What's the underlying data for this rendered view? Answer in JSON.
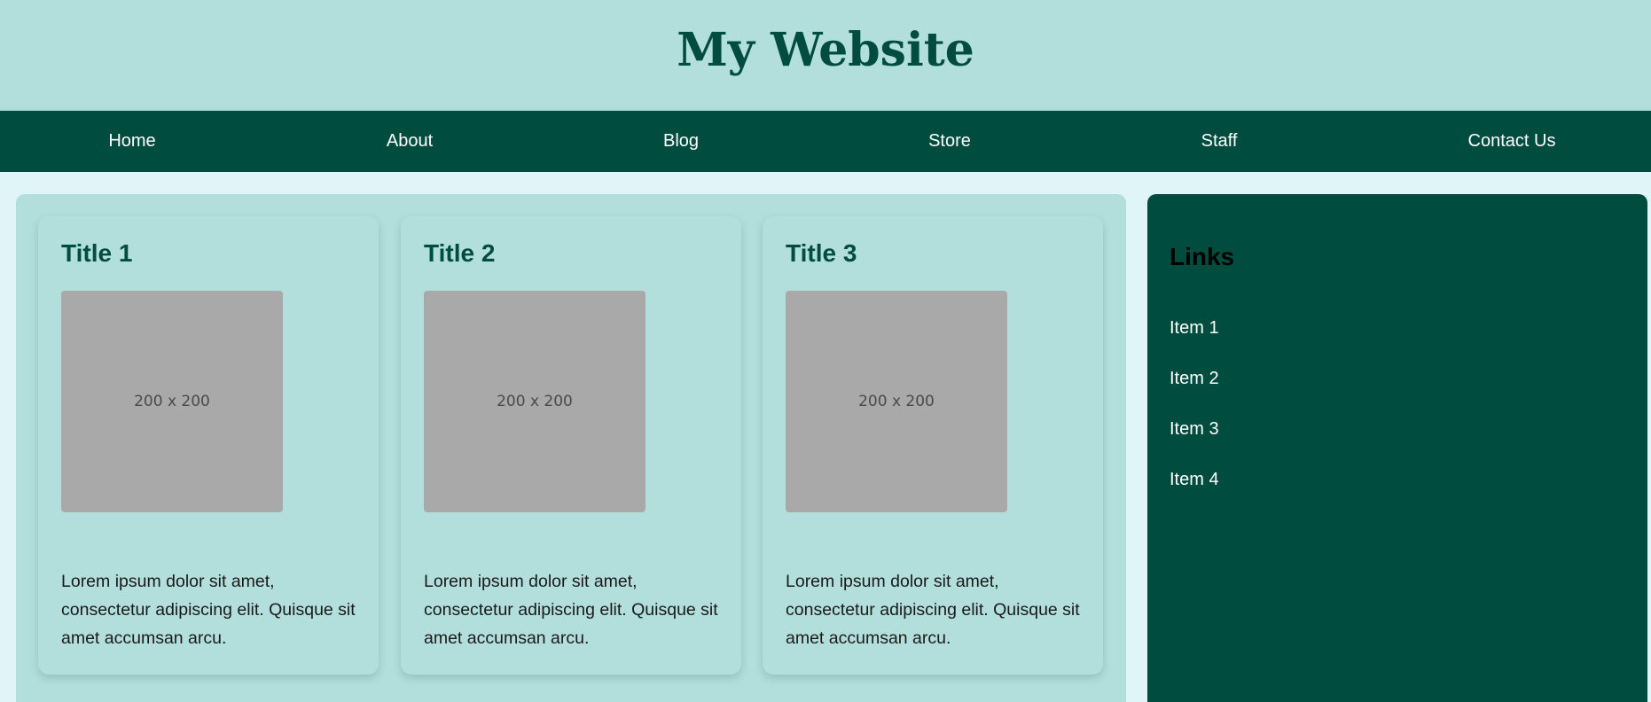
{
  "header": {
    "title": "My Website"
  },
  "nav": {
    "items": [
      {
        "label": "Home"
      },
      {
        "label": "About"
      },
      {
        "label": "Blog"
      },
      {
        "label": "Store"
      },
      {
        "label": "Staff"
      },
      {
        "label": "Contact Us"
      }
    ]
  },
  "cards": [
    {
      "title": "Title 1",
      "image_label": "200 x 200",
      "text": "Lorem ipsum dolor sit amet, consectetur adipiscing elit. Quisque sit amet accumsan arcu."
    },
    {
      "title": "Title 2",
      "image_label": "200 x 200",
      "text": "Lorem ipsum dolor sit amet, consectetur adipiscing elit. Quisque sit amet accumsan arcu."
    },
    {
      "title": "Title 3",
      "image_label": "200 x 200",
      "text": "Lorem ipsum dolor sit amet, consectetur adipiscing elit. Quisque sit amet accumsan arcu."
    }
  ],
  "sidebar": {
    "title": "Links",
    "items": [
      {
        "label": "Item 1"
      },
      {
        "label": "Item 2"
      },
      {
        "label": "Item 3"
      },
      {
        "label": "Item 4"
      }
    ]
  },
  "colors": {
    "primary_dark": "#004d40",
    "primary_light": "#b2dfdc",
    "background": "#dff5f7",
    "placeholder": "#a9a9a9"
  }
}
